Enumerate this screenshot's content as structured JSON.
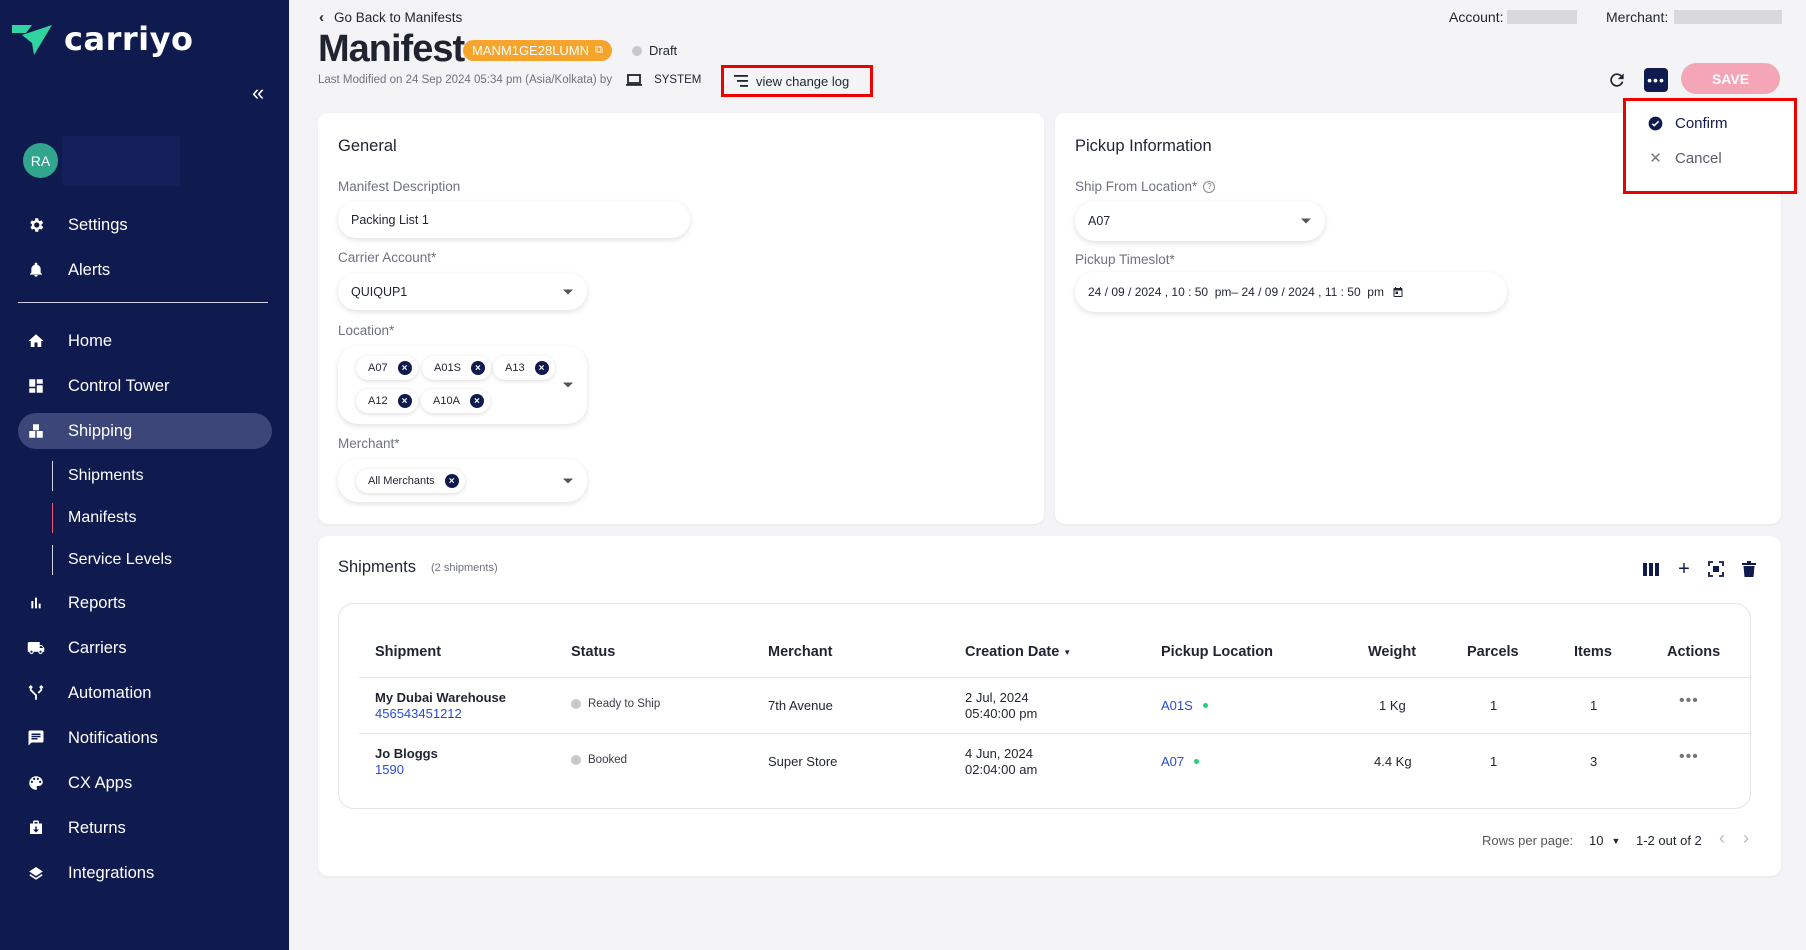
{
  "sidebar": {
    "logo_text": "carriyo",
    "avatar_initials": "RA",
    "top_items": [
      {
        "label": "Settings",
        "icon": "gear-icon"
      },
      {
        "label": "Alerts",
        "icon": "bell-icon"
      }
    ],
    "nav_items": [
      {
        "label": "Home",
        "icon": "home-icon"
      },
      {
        "label": "Control Tower",
        "icon": "dashboard-icon"
      },
      {
        "label": "Shipping",
        "icon": "shipping-icon",
        "active": true
      },
      {
        "label": "Reports",
        "icon": "bar-chart-icon"
      },
      {
        "label": "Carriers",
        "icon": "truck-icon"
      },
      {
        "label": "Automation",
        "icon": "fork-icon"
      },
      {
        "label": "Notifications",
        "icon": "chat-icon"
      },
      {
        "label": "CX Apps",
        "icon": "palette-icon"
      },
      {
        "label": "Returns",
        "icon": "return-box-icon"
      },
      {
        "label": "Integrations",
        "icon": "layers-icon"
      }
    ],
    "sub_items": [
      {
        "label": "Shipments"
      },
      {
        "label": "Manifests",
        "active": true
      },
      {
        "label": "Service Levels"
      }
    ]
  },
  "header": {
    "back_label": "Go Back to Manifests",
    "title": "Manifest",
    "manifest_id": "MANM1GE28LUMN",
    "status": "Draft",
    "last_modified": "Last Modified on 24 Sep 2024 05:34 pm (Asia/Kolkata) by",
    "modified_by": "SYSTEM",
    "change_log_label": "view change log",
    "account_label": "Account:",
    "merchant_label": "Merchant:",
    "save_label": "SAVE"
  },
  "more_menu": {
    "items": [
      {
        "label": "Confirm",
        "icon": "check-circle-icon"
      },
      {
        "label": "Cancel",
        "icon": "close-icon"
      }
    ]
  },
  "general": {
    "title": "General",
    "description_label": "Manifest Description",
    "description_value": "Packing List 1",
    "carrier_label": "Carrier Account*",
    "carrier_value": "QUIQUP1",
    "location_label": "Location*",
    "locations": [
      "A07",
      "A01S",
      "A13",
      "A12",
      "A10A"
    ],
    "merchant_label": "Merchant*",
    "merchant_value": "All Merchants"
  },
  "pickup": {
    "title": "Pickup Information",
    "ship_from_label": "Ship From Location*",
    "ship_from_value": "A07",
    "timeslot_label": "Pickup Timeslot*",
    "timeslot_value": "24 / 09 / 2024 , 10 : 50  pm– 24 / 09 / 2024 , 11 : 50  pm"
  },
  "shipments": {
    "title": "Shipments",
    "count": "(2 shipments)",
    "columns": [
      "Shipment",
      "Status",
      "Merchant",
      "Creation Date",
      "Pickup Location",
      "Weight",
      "Parcels",
      "Items",
      "Actions"
    ],
    "rows": [
      {
        "name": "My Dubai Warehouse",
        "id": "456543451212",
        "status": "Ready to Ship",
        "merchant": "7th Avenue",
        "date": "2 Jul, 2024",
        "time": "05:40:00 pm",
        "location": "A01S",
        "weight": "1 Kg",
        "parcels": "1",
        "items": "1"
      },
      {
        "name": "Jo Bloggs",
        "id": "1590",
        "status": "Booked",
        "merchant": "Super Store",
        "date": "4 Jun, 2024",
        "time": "02:04:00 am",
        "location": "A07",
        "weight": "4.4 Kg",
        "parcels": "1",
        "items": "3"
      }
    ],
    "rows_per_page_label": "Rows per page:",
    "rows_per_page": "10",
    "page_range": "1-2 out of 2"
  }
}
